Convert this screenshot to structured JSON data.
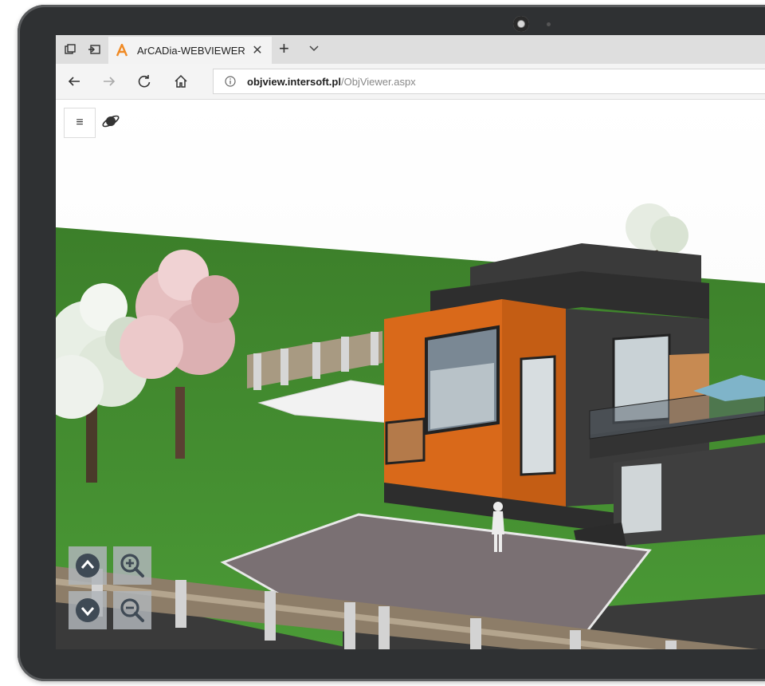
{
  "browser": {
    "tab_title": "ArCADia-WEBVIEWER",
    "new_tab_label": "+",
    "url_domain": "objview.intersoft.pl",
    "url_path": "/ObjViewer.aspx"
  },
  "viewer": {
    "menu_icon": "≡"
  },
  "icons": {
    "tab_logo": "arcadia-logo-icon",
    "back": "arrow-left-icon",
    "forward": "arrow-right-icon",
    "refresh": "refresh-icon",
    "home": "home-icon",
    "info": "info-icon",
    "planet": "planet-icon",
    "move_up": "chevron-up-icon",
    "move_down": "chevron-down-icon",
    "zoom_in": "zoom-in-icon",
    "zoom_out": "zoom-out-icon"
  },
  "colors": {
    "accent": "#f08a24",
    "grass": "#3f8a2e",
    "house_orange": "#d9691a",
    "house_dark": "#3a3a3a",
    "control_bg": "#afb4b9",
    "control_icon": "#3f4a55"
  }
}
